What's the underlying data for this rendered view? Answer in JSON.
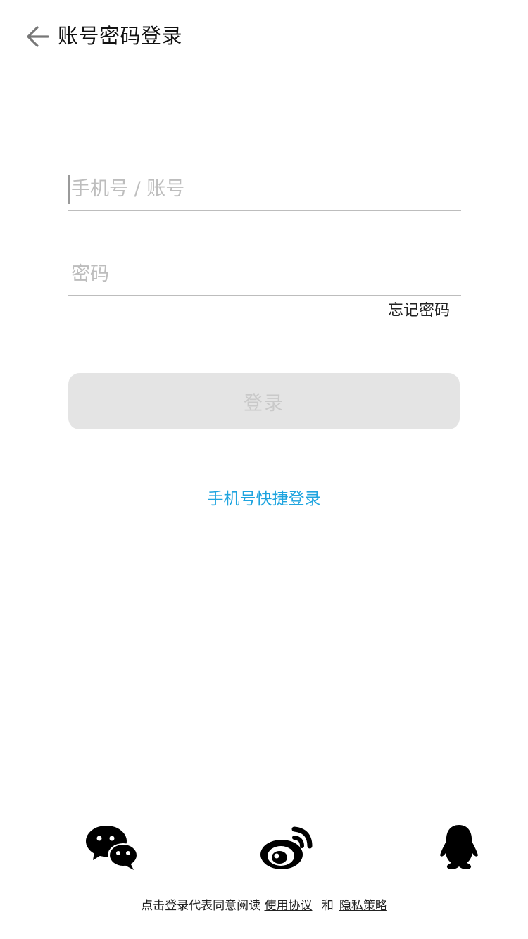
{
  "header": {
    "title": "账号密码登录",
    "back_icon": "arrow-left-icon"
  },
  "form": {
    "account_placeholder": "手机号 / 账号",
    "account_value": "",
    "password_placeholder": "密码",
    "password_value": "",
    "forgot_password": "忘记密码",
    "login_label": "登录"
  },
  "quick_login": "手机号快捷登录",
  "social": {
    "icons": [
      "wechat-icon",
      "weibo-icon",
      "qq-icon"
    ]
  },
  "agreement": {
    "prefix": "点击登录代表同意阅读",
    "terms": "使用协议",
    "and": "和",
    "privacy": "隐私策略"
  },
  "colors": {
    "accent": "#1ea4df",
    "button_bg": "#e4e4e4",
    "button_text": "#c9c9c9",
    "placeholder": "#bdbdbd",
    "divider": "#bdbdbd"
  }
}
